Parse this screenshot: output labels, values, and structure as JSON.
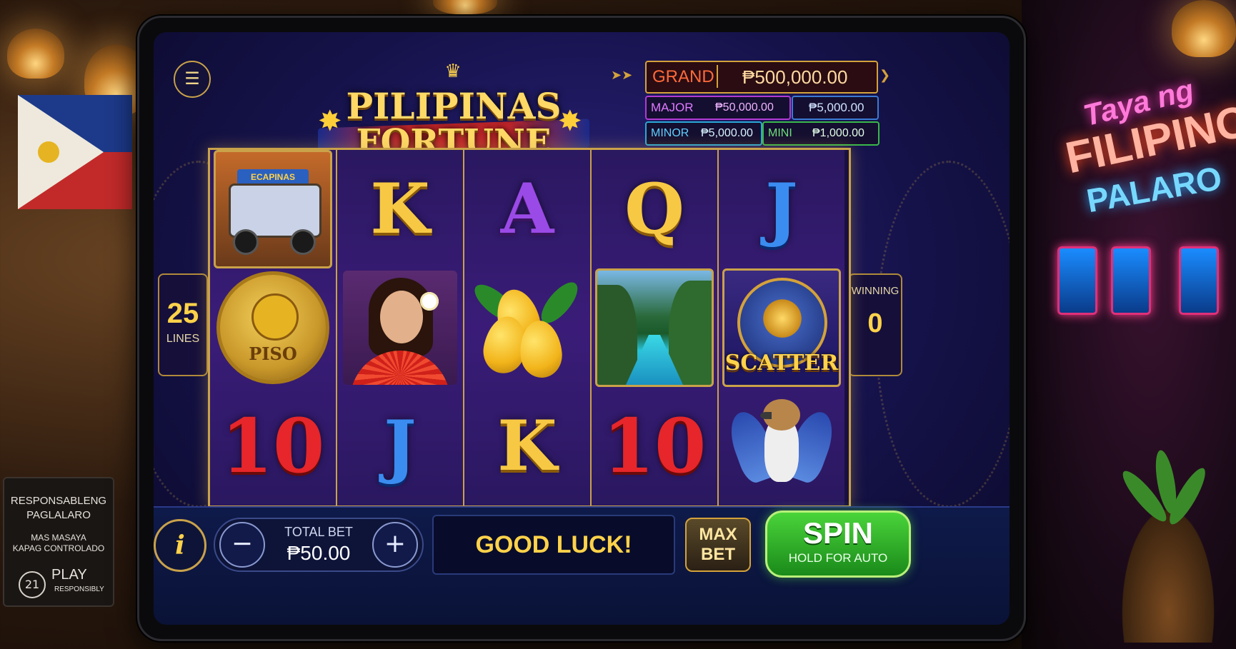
{
  "game": {
    "title_line1": "PILIPINAS",
    "title_line2": "FORTUNE"
  },
  "jackpots": {
    "grand": {
      "label": "GRAND",
      "value": "₱500,000.00"
    },
    "major": {
      "label": "MAJOR",
      "value": "₱50,000.00"
    },
    "major_extra": {
      "value": "₱5,000.00"
    },
    "minor": {
      "label": "MINOR",
      "value": "₱5,000.00"
    },
    "mini": {
      "label": "MINI",
      "value": "₱1,000.00"
    }
  },
  "lines": {
    "value": "25",
    "label": "LINES"
  },
  "winning": {
    "label": "WINNING",
    "value": "0"
  },
  "reels": [
    [
      "jeepney",
      "piso-coin",
      "10"
    ],
    [
      "K",
      "filipina",
      "J"
    ],
    [
      "A",
      "mango",
      "K"
    ],
    [
      "Q",
      "river",
      "10"
    ],
    [
      "J",
      "scatter",
      "eagle"
    ]
  ],
  "symbol_text": {
    "jeepney_sign": "ECAPINAS",
    "coin": "PISO",
    "scatter": "SCATTER"
  },
  "controls": {
    "info_label": "i",
    "minus_label": "−",
    "plus_label": "+",
    "total_bet_label": "TOTAL BET",
    "total_bet_value": "₱50.00",
    "message": "GOOD LUCK!",
    "max_bet_line1": "MAX",
    "max_bet_line2": "BET",
    "spin_label": "SPIN",
    "spin_sub": "HOLD FOR AUTO",
    "menu_icon": "hamburger-icon"
  },
  "background": {
    "responsible_card": {
      "line1": "RESPONSABLENG",
      "line2": "PAGLALARO",
      "line3": "MAS MASAYA",
      "line4": "KAPAG CONTROLADO",
      "age": "21",
      "play": "PLAY",
      "responsibly": "RESPONSIBLY"
    },
    "neon": {
      "line1": "Taya ng",
      "line2": "FILIPINO",
      "line3": "PALARO"
    }
  },
  "colors": {
    "gold": "#c9a24a",
    "spin_green": "#2aa82a",
    "screen_blue": "#15124a"
  }
}
